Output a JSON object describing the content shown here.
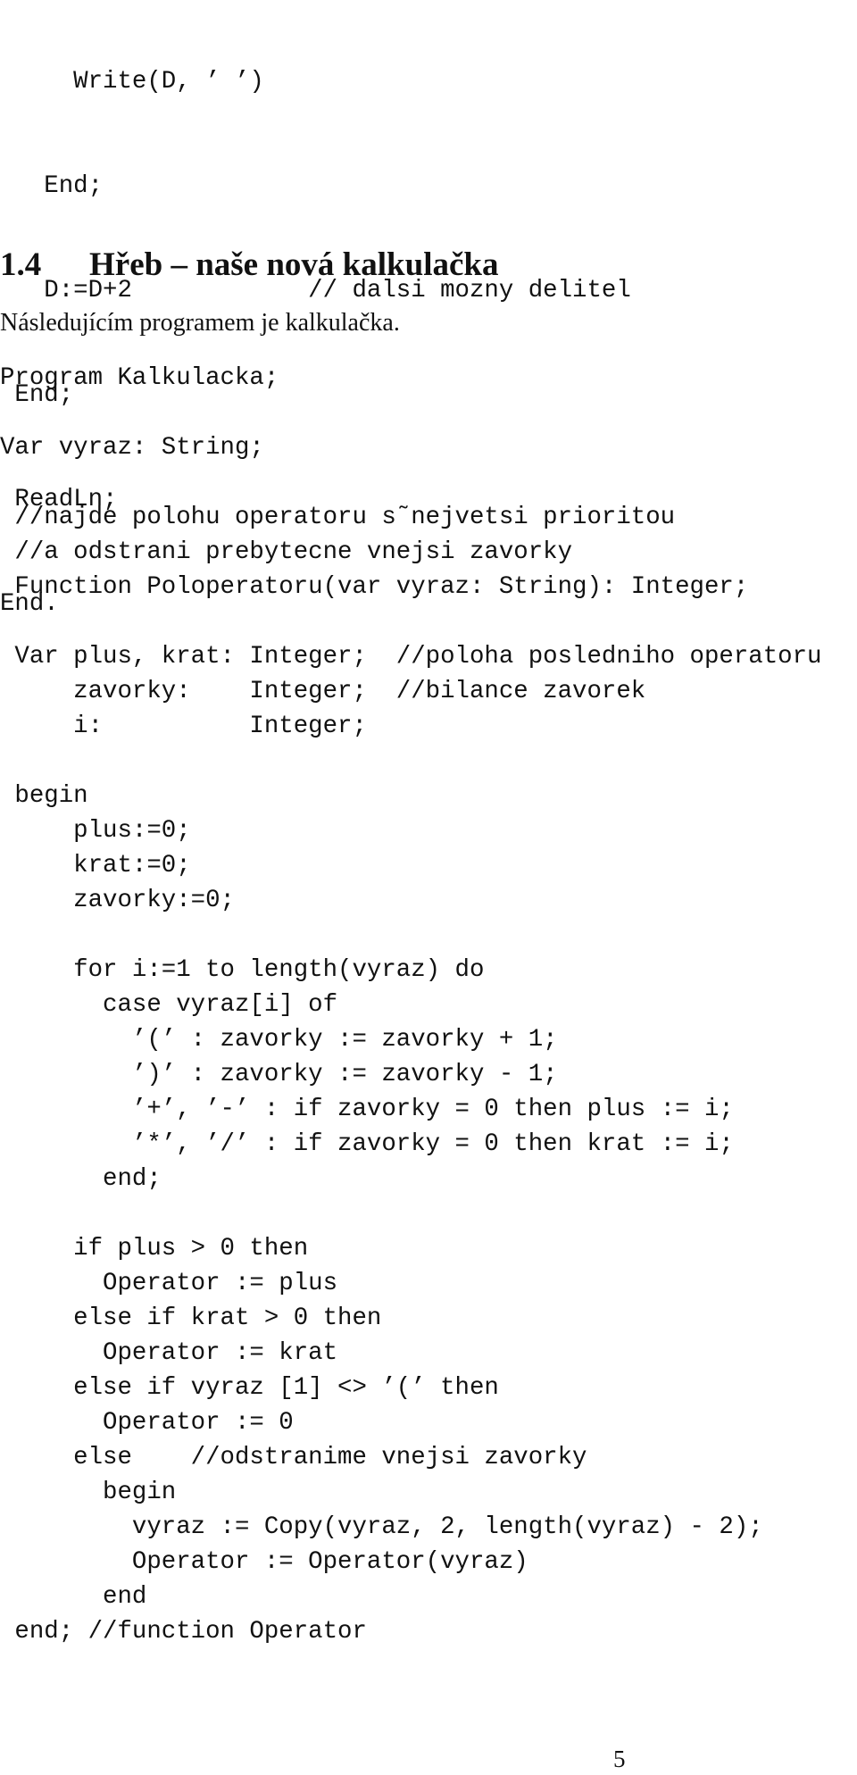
{
  "code_top": [
    "     Write(D, ’ ’)",
    "   End;",
    "   D:=D+2            // dalsi mozny delitel",
    " End;",
    " ReadLn;",
    "End."
  ],
  "section": {
    "number": "1.4",
    "title": "Hřeb – naše nová kalkulačka"
  },
  "intro": "Následujícím programem je kalkulačka.",
  "code_main": [
    "Program Kalkulacka;",
    "",
    "Var vyraz: String;",
    "",
    " //najde polohu operatoru s˜nejvetsi prioritou",
    " //a odstrani prebytecne vnejsi zavorky",
    " Function Poloperatoru(var vyraz: String): Integer;",
    "",
    " Var plus, krat: Integer;  //poloha posledniho operatoru",
    "     zavorky:    Integer;  //bilance zavorek",
    "     i:          Integer;",
    "",
    " begin",
    "     plus:=0;",
    "     krat:=0;",
    "     zavorky:=0;",
    "",
    "     for i:=1 to length(vyraz) do",
    "       case vyraz[i] of",
    "         ’(’ : zavorky := zavorky + 1;",
    "         ’)’ : zavorky := zavorky - 1;",
    "         ’+’, ’-’ : if zavorky = 0 then plus := i;",
    "         ’*’, ’/’ : if zavorky = 0 then krat := i;",
    "       end;",
    "",
    "     if plus > 0 then",
    "       Operator := plus",
    "     else if krat > 0 then",
    "       Operator := krat",
    "     else if vyraz [1] <> ’(’ then",
    "       Operator := 0",
    "     else    //odstranime vnejsi zavorky",
    "       begin",
    "         vyraz := Copy(vyraz, 2, length(vyraz) - 2);",
    "         Operator := Operator(vyraz)",
    "       end",
    " end; //function Operator"
  ],
  "page_number": "5"
}
